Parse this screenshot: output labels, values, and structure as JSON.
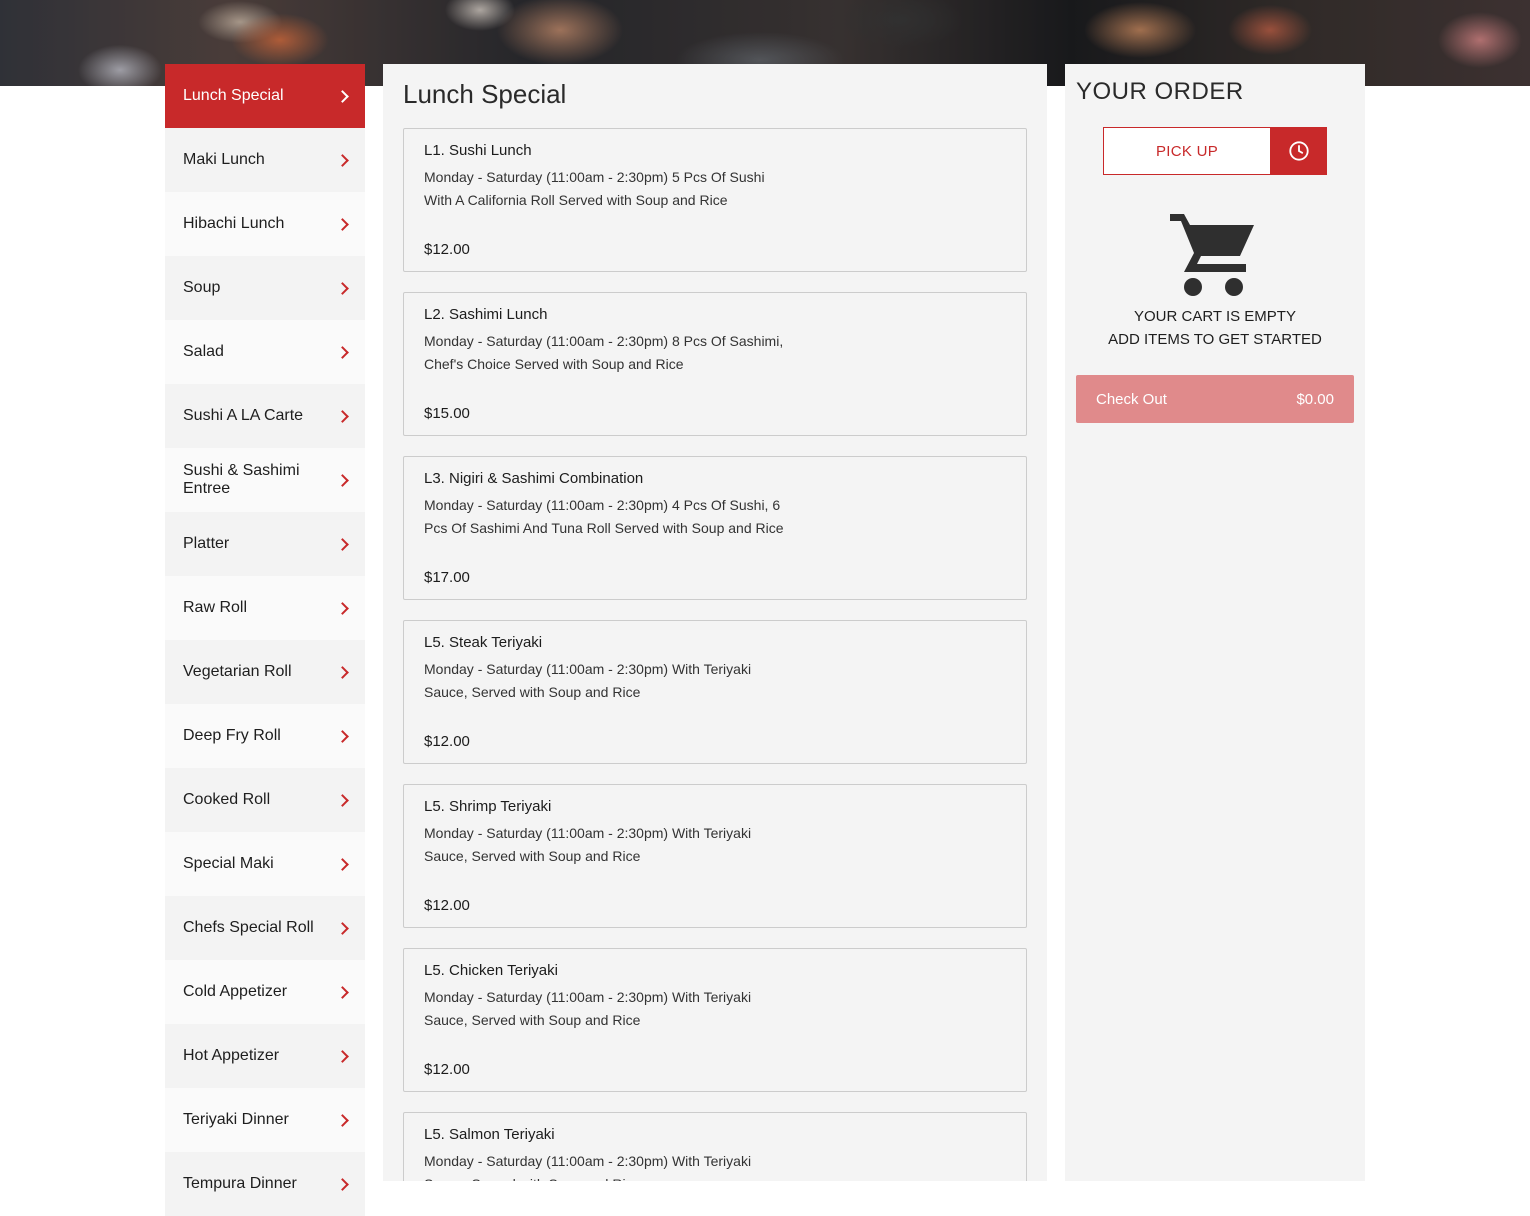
{
  "categories": [
    "Lunch Special",
    "Maki Lunch",
    "Hibachi Lunch",
    "Soup",
    "Salad",
    "Sushi A LA Carte",
    "Sushi & Sashimi Entree",
    "Platter",
    "Raw Roll",
    "Vegetarian Roll",
    "Deep Fry Roll",
    "Cooked Roll",
    "Special Maki",
    "Chefs Special Roll",
    "Cold Appetizer",
    "Hot Appetizer",
    "Teriyaki Dinner",
    "Tempura Dinner"
  ],
  "active_category_index": 0,
  "menu": {
    "section_title": "Lunch Special",
    "items": [
      {
        "name": "L1. Sushi Lunch",
        "description": "Monday - Saturday (11:00am - 2:30pm) 5 Pcs Of Sushi With A California Roll Served with Soup and Rice",
        "price": "$12.00"
      },
      {
        "name": "L2. Sashimi Lunch",
        "description": "Monday - Saturday (11:00am - 2:30pm) 8 Pcs Of Sashimi, Chef's Choice Served with Soup and Rice",
        "price": "$15.00"
      },
      {
        "name": "L3. Nigiri & Sashimi Combination",
        "description": "Monday - Saturday (11:00am - 2:30pm) 4 Pcs Of Sushi, 6 Pcs Of Sashimi And Tuna Roll Served with Soup and Rice",
        "price": "$17.00"
      },
      {
        "name": "L5. Steak Teriyaki",
        "description": "Monday - Saturday (11:00am - 2:30pm) With Teriyaki Sauce, Served with Soup and Rice",
        "price": "$12.00"
      },
      {
        "name": "L5. Shrimp Teriyaki",
        "description": "Monday - Saturday (11:00am - 2:30pm) With Teriyaki Sauce, Served with Soup and Rice",
        "price": "$12.00"
      },
      {
        "name": "L5. Chicken Teriyaki",
        "description": "Monday - Saturday (11:00am - 2:30pm) With Teriyaki Sauce, Served with Soup and Rice",
        "price": "$12.00"
      },
      {
        "name": "L5. Salmon Teriyaki",
        "description": "Monday - Saturday (11:00am - 2:30pm) With Teriyaki Sauce, Served with Soup and Rice",
        "price": ""
      }
    ]
  },
  "order": {
    "title": "YOUR ORDER",
    "pickup_label": "PICK UP",
    "empty_line1": "YOUR CART IS EMPTY",
    "empty_line2": "ADD ITEMS TO GET STARTED",
    "checkout_label": "Check Out",
    "checkout_total": "$0.00"
  },
  "colors": {
    "accent": "#c8292a",
    "checkout_disabled": "#e08a8b",
    "panel_bg": "#f4f4f4"
  },
  "icons": {
    "category_arrow": "chevron-right-icon",
    "schedule": "clock-icon",
    "cart": "shopping-cart-icon"
  }
}
